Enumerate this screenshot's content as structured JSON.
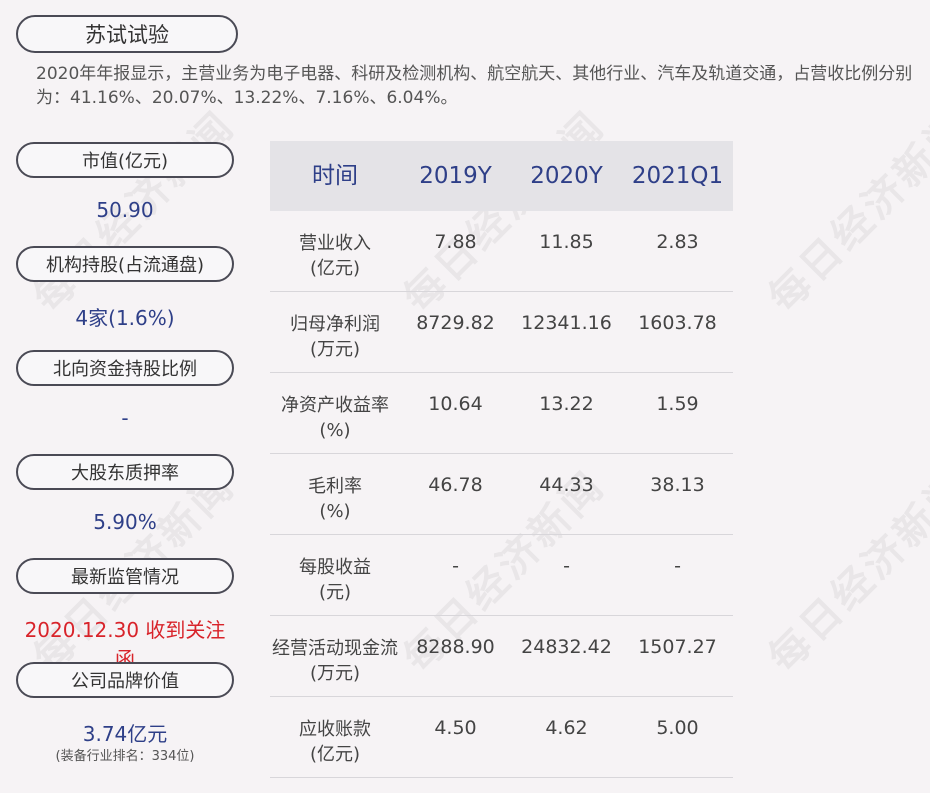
{
  "title": "苏试试验",
  "summary": "2020年年报显示，主营业务为电子电器、科研及检测机构、航空航天、其他行业、汽车及轨道交通，占营收比例分别为：41.16%、20.07%、13.22%、7.16%、6.04%。",
  "watermark": "每日经济新闻",
  "left": {
    "market_cap_label": "市值(亿元)",
    "market_cap_value": "50.90",
    "inst_label": "机构持股(占流通盘)",
    "inst_value": "4家(1.6%)",
    "north_label": "北向资金持股比例",
    "north_value": "-",
    "pledge_label": "大股东质押率",
    "pledge_value": "5.90%",
    "reg_label": "最新监管情况",
    "reg_value": "2020.12.30 收到关注函",
    "brand_label": "公司品牌价值",
    "brand_value": "3.74亿元",
    "brand_sub": "(装备行业排名：334位)"
  },
  "table": {
    "headers": [
      "时间",
      "2019Y",
      "2020Y",
      "2021Q1"
    ],
    "rows": [
      {
        "label1": "营业收入",
        "label2": "(亿元)",
        "values": [
          "7.88",
          "11.85",
          "2.83"
        ]
      },
      {
        "label1": "归母净利润",
        "label2": "(万元)",
        "values": [
          "8729.82",
          "12341.16",
          "1603.78"
        ]
      },
      {
        "label1": "净资产收益率",
        "label2": "(%)",
        "values": [
          "10.64",
          "13.22",
          "1.59"
        ]
      },
      {
        "label1": "毛利率",
        "label2": "(%)",
        "values": [
          "46.78",
          "44.33",
          "38.13"
        ]
      },
      {
        "label1": "每股收益",
        "label2": "(元)",
        "values": [
          "-",
          "-",
          "-"
        ]
      },
      {
        "label1": "经营活动现金流",
        "label2": "(万元)",
        "values": [
          "8288.90",
          "24832.42",
          "1507.27"
        ]
      },
      {
        "label1": "应收账款",
        "label2": "(亿元)",
        "values": [
          "4.50",
          "4.62",
          "5.00"
        ]
      }
    ]
  },
  "colors": {
    "background": "#f6f3f5",
    "accent_blue": "#2e3f88",
    "alert_red": "#d8232a",
    "header_bg": "#e4e3e7"
  }
}
